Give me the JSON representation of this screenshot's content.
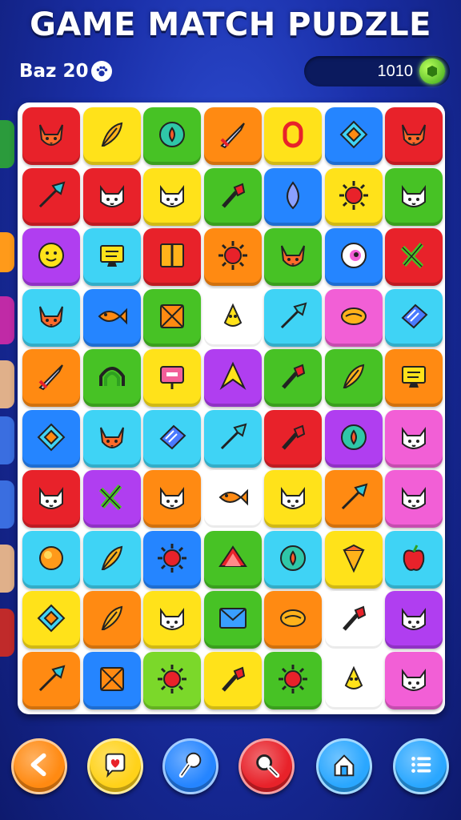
{
  "header": {
    "title": "GAME MATCH PUDZLE",
    "player_name": "Baz 20",
    "player_icon": "paw-icon",
    "score": "1010",
    "score_icon": "gem-icon"
  },
  "colors": {
    "red": "#e8222a",
    "yellow": "#ffe21a",
    "green": "#47c225",
    "orange": "#ff8a12",
    "blue": "#2585ff",
    "purple": "#b03ef0",
    "cyan": "#3fd3f5",
    "white": "#ffffff",
    "pink": "#f25fd6",
    "lime": "#7bd82a"
  },
  "board": {
    "rows": [
      [
        {
          "c": "red",
          "i": "fox"
        },
        {
          "c": "yellow",
          "i": "feather"
        },
        {
          "c": "green",
          "i": "orb"
        },
        {
          "c": "orange",
          "i": "sword"
        },
        {
          "c": "yellow",
          "i": "ring"
        },
        {
          "c": "blue",
          "i": "gem"
        },
        {
          "c": "red",
          "i": "fox"
        }
      ],
      [
        {
          "c": "red",
          "i": "arrow"
        },
        {
          "c": "red",
          "i": "cat"
        },
        {
          "c": "yellow",
          "i": "cat"
        },
        {
          "c": "green",
          "i": "brush"
        },
        {
          "c": "blue",
          "i": "drop"
        },
        {
          "c": "yellow",
          "i": "sun"
        },
        {
          "c": "green",
          "i": "cat"
        }
      ],
      [
        {
          "c": "purple",
          "i": "face"
        },
        {
          "c": "cyan",
          "i": "screen"
        },
        {
          "c": "red",
          "i": "book"
        },
        {
          "c": "orange",
          "i": "sun"
        },
        {
          "c": "green",
          "i": "fox"
        },
        {
          "c": "blue",
          "i": "eye"
        },
        {
          "c": "red",
          "i": "cross"
        }
      ],
      [
        {
          "c": "cyan",
          "i": "fox"
        },
        {
          "c": "blue",
          "i": "fish"
        },
        {
          "c": "green",
          "i": "box"
        },
        {
          "c": "white",
          "i": "bird"
        },
        {
          "c": "cyan",
          "i": "arrow"
        },
        {
          "c": "pink",
          "i": "lemon"
        },
        {
          "c": "cyan",
          "i": "card"
        }
      ],
      [
        {
          "c": "orange",
          "i": "sword"
        },
        {
          "c": "green",
          "i": "arch"
        },
        {
          "c": "yellow",
          "i": "sign"
        },
        {
          "c": "purple",
          "i": "peak"
        },
        {
          "c": "green",
          "i": "brush"
        },
        {
          "c": "green",
          "i": "feather"
        },
        {
          "c": "orange",
          "i": "screen"
        }
      ],
      [
        {
          "c": "blue",
          "i": "gem"
        },
        {
          "c": "cyan",
          "i": "fox"
        },
        {
          "c": "cyan",
          "i": "card"
        },
        {
          "c": "cyan",
          "i": "arrow"
        },
        {
          "c": "red",
          "i": "brush"
        },
        {
          "c": "purple",
          "i": "orb"
        },
        {
          "c": "pink",
          "i": "cat"
        }
      ],
      [
        {
          "c": "red",
          "i": "cat"
        },
        {
          "c": "purple",
          "i": "cross"
        },
        {
          "c": "orange",
          "i": "cat"
        },
        {
          "c": "white",
          "i": "fish"
        },
        {
          "c": "yellow",
          "i": "cat"
        },
        {
          "c": "orange",
          "i": "arrow"
        },
        {
          "c": "pink",
          "i": "cat"
        }
      ],
      [
        {
          "c": "cyan",
          "i": "ball"
        },
        {
          "c": "cyan",
          "i": "feather"
        },
        {
          "c": "blue",
          "i": "sun"
        },
        {
          "c": "green",
          "i": "slice"
        },
        {
          "c": "cyan",
          "i": "orb"
        },
        {
          "c": "yellow",
          "i": "cone"
        },
        {
          "c": "cyan",
          "i": "apple"
        }
      ],
      [
        {
          "c": "yellow",
          "i": "gem"
        },
        {
          "c": "orange",
          "i": "feather"
        },
        {
          "c": "yellow",
          "i": "cat"
        },
        {
          "c": "green",
          "i": "mail"
        },
        {
          "c": "orange",
          "i": "lemon"
        },
        {
          "c": "white",
          "i": "brush"
        },
        {
          "c": "purple",
          "i": "cat"
        }
      ],
      [
        {
          "c": "orange",
          "i": "arrow"
        },
        {
          "c": "blue",
          "i": "box"
        },
        {
          "c": "lime",
          "i": "sun"
        },
        {
          "c": "yellow",
          "i": "brush"
        },
        {
          "c": "green",
          "i": "sun"
        },
        {
          "c": "white",
          "i": "bird"
        },
        {
          "c": "pink",
          "i": "cat"
        }
      ]
    ]
  },
  "controls": [
    {
      "name": "back-button",
      "icon": "chevron-left-icon",
      "color": "#ff8a12"
    },
    {
      "name": "hint-button",
      "icon": "heart-chat-icon",
      "color": "#ffd21a"
    },
    {
      "name": "hammer-button",
      "icon": "hammer-icon",
      "color": "#2585ff"
    },
    {
      "name": "search-button",
      "icon": "magnifier-icon",
      "color": "#e8222a"
    },
    {
      "name": "home-button",
      "icon": "home-icon",
      "color": "#2aa7ff"
    },
    {
      "name": "menu-button",
      "icon": "list-icon",
      "color": "#2aa7ff"
    }
  ]
}
